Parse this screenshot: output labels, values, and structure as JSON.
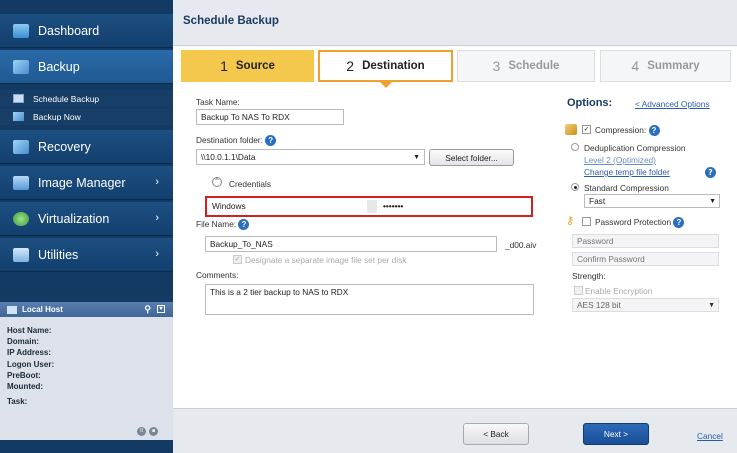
{
  "sidebar": {
    "dashboard": "Dashboard",
    "backup": "Backup",
    "schedule_backup": "Schedule Backup",
    "backup_now": "Backup Now",
    "recovery": "Recovery",
    "image_manager": "Image Manager",
    "virtualization": "Virtualization",
    "utilities": "Utilities"
  },
  "local_host": {
    "title": "Local Host",
    "fields": [
      "Host Name:",
      "Domain:",
      "IP Address:",
      "Logon User:",
      "PreBoot:",
      "Mounted:",
      "Task:"
    ]
  },
  "header": {
    "title": "Schedule Backup"
  },
  "steps": [
    {
      "num": "1",
      "label": "Source"
    },
    {
      "num": "2",
      "label": "Destination"
    },
    {
      "num": "3",
      "label": "Schedule"
    },
    {
      "num": "4",
      "label": "Summary"
    }
  ],
  "form": {
    "task_name_label": "Task Name:",
    "task_name_value": "Backup To NAS To RDX",
    "dest_folder_label": "Destination folder:",
    "dest_folder_value": "\\\\10.0.1.1\\Data",
    "select_folder": "Select folder...",
    "credentials": "Credentials",
    "cred_user": "Windows",
    "cred_pass": "•••••••",
    "file_name_label": "File Name:",
    "file_name_value": "Backup_To_NAS",
    "file_suffix": "_d00.aiv",
    "separate_set": "Designate a separate image file set per disk",
    "comments_label": "Comments:",
    "comments_value": "This is a 2 tier backup to NAS to RDX"
  },
  "options": {
    "title": "Options:",
    "advanced": "< Advanced Options",
    "compression": "Compression:",
    "dedup": "Deduplication Compression",
    "level": "Level 2 (Optimized)",
    "change_temp": "Change temp file folder",
    "standard": "Standard Compression",
    "speed": "Fast",
    "password_protection": "Password Protection",
    "password_placeholder": "Password",
    "confirm_placeholder": "Confirm Password",
    "strength": "Strength:",
    "enable_encryption": "Enable Encryption",
    "encryption": "AES 128 bit"
  },
  "footer": {
    "back": "< Back",
    "next": "Next >",
    "cancel": "Cancel"
  },
  "colors": {
    "sidebar": "#123a63",
    "active_step": "#f3c84d",
    "accent_orange": "#f0a030",
    "highlight_red": "#d32020",
    "next_button": "#1a4f95"
  }
}
